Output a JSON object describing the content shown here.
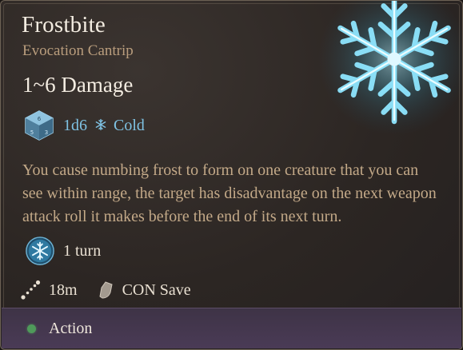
{
  "spell": {
    "name": "Frostbite",
    "school": "Evocation Cantrip",
    "damage": "1~6 Damage",
    "dice": "1d6",
    "damage_type": "Cold",
    "description": "You cause numbing frost to form on one creature that you can see within range, the target has disadvantage on the next weapon attack roll it makes before the end of its next turn.",
    "duration": "1 turn",
    "range": "18m",
    "save": "CON Save",
    "cost": "Action"
  },
  "icons": {
    "spell_art": "snowflake-icon",
    "dice": "d6-dice-icon",
    "damage_type": "cold-snowflake-icon",
    "duration": "frost-condition-icon",
    "range": "range-icon",
    "save": "shield-save-icon",
    "cost": "action-dot-icon"
  },
  "colors": {
    "cold_accent": "#7fc2e3",
    "subtitle": "#b99d7d",
    "description": "#c3a988",
    "action_dot": "#4f9a5a",
    "footer_bg": "#45384f"
  }
}
